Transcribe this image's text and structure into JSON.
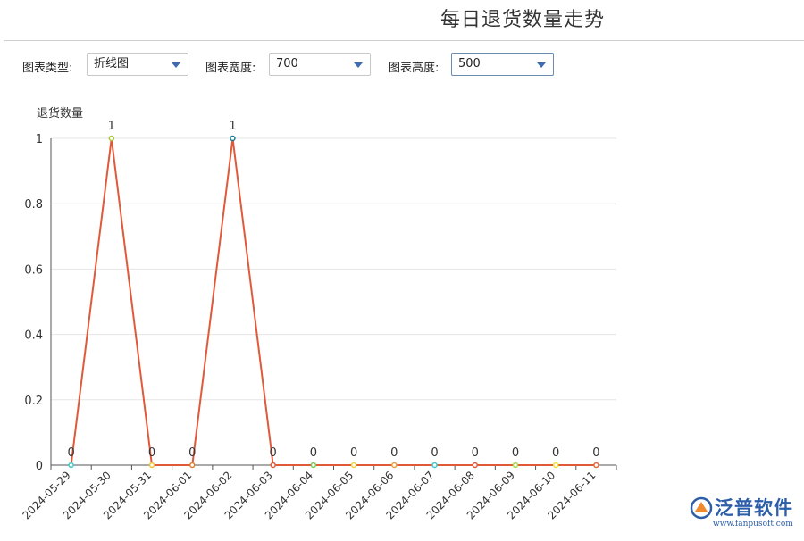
{
  "page": {
    "title": "每日退货数量走势"
  },
  "controls": {
    "type_label": "图表类型:",
    "type_value": "折线图",
    "width_label": "图表宽度:",
    "width_value": "700",
    "height_label": "图表高度:",
    "height_value": "500"
  },
  "watermark": {
    "name": "泛普软件",
    "url": "www.fanpusoft.com"
  },
  "chart_data": {
    "type": "line",
    "ylabel": "退货数量",
    "ylim": [
      0,
      1
    ],
    "yticks": [
      "0",
      "0.2",
      "0.4",
      "0.6",
      "0.8",
      "1"
    ],
    "grid": true,
    "categories": [
      "2024-05-29",
      "2024-05-30",
      "2024-05-31",
      "2024-06-01",
      "2024-06-02",
      "2024-06-03",
      "2024-06-04",
      "2024-06-05",
      "2024-06-06",
      "2024-06-07",
      "2024-06-08",
      "2024-06-09",
      "2024-06-10",
      "2024-06-11"
    ],
    "values": [
      0,
      1,
      0,
      0,
      1,
      0,
      0,
      0,
      0,
      0,
      0,
      0,
      0,
      0
    ],
    "line_color": "#e05a3a",
    "point_colors": [
      "#3cc8c8",
      "#a8c83c",
      "#f0c030",
      "#e07a30",
      "#1f7a8c",
      "#e05a3a",
      "#7ac850",
      "#f0d040",
      "#e8a040",
      "#3cc8c8",
      "#e05a3a",
      "#a8d840",
      "#f0e030",
      "#e06a3a"
    ]
  }
}
